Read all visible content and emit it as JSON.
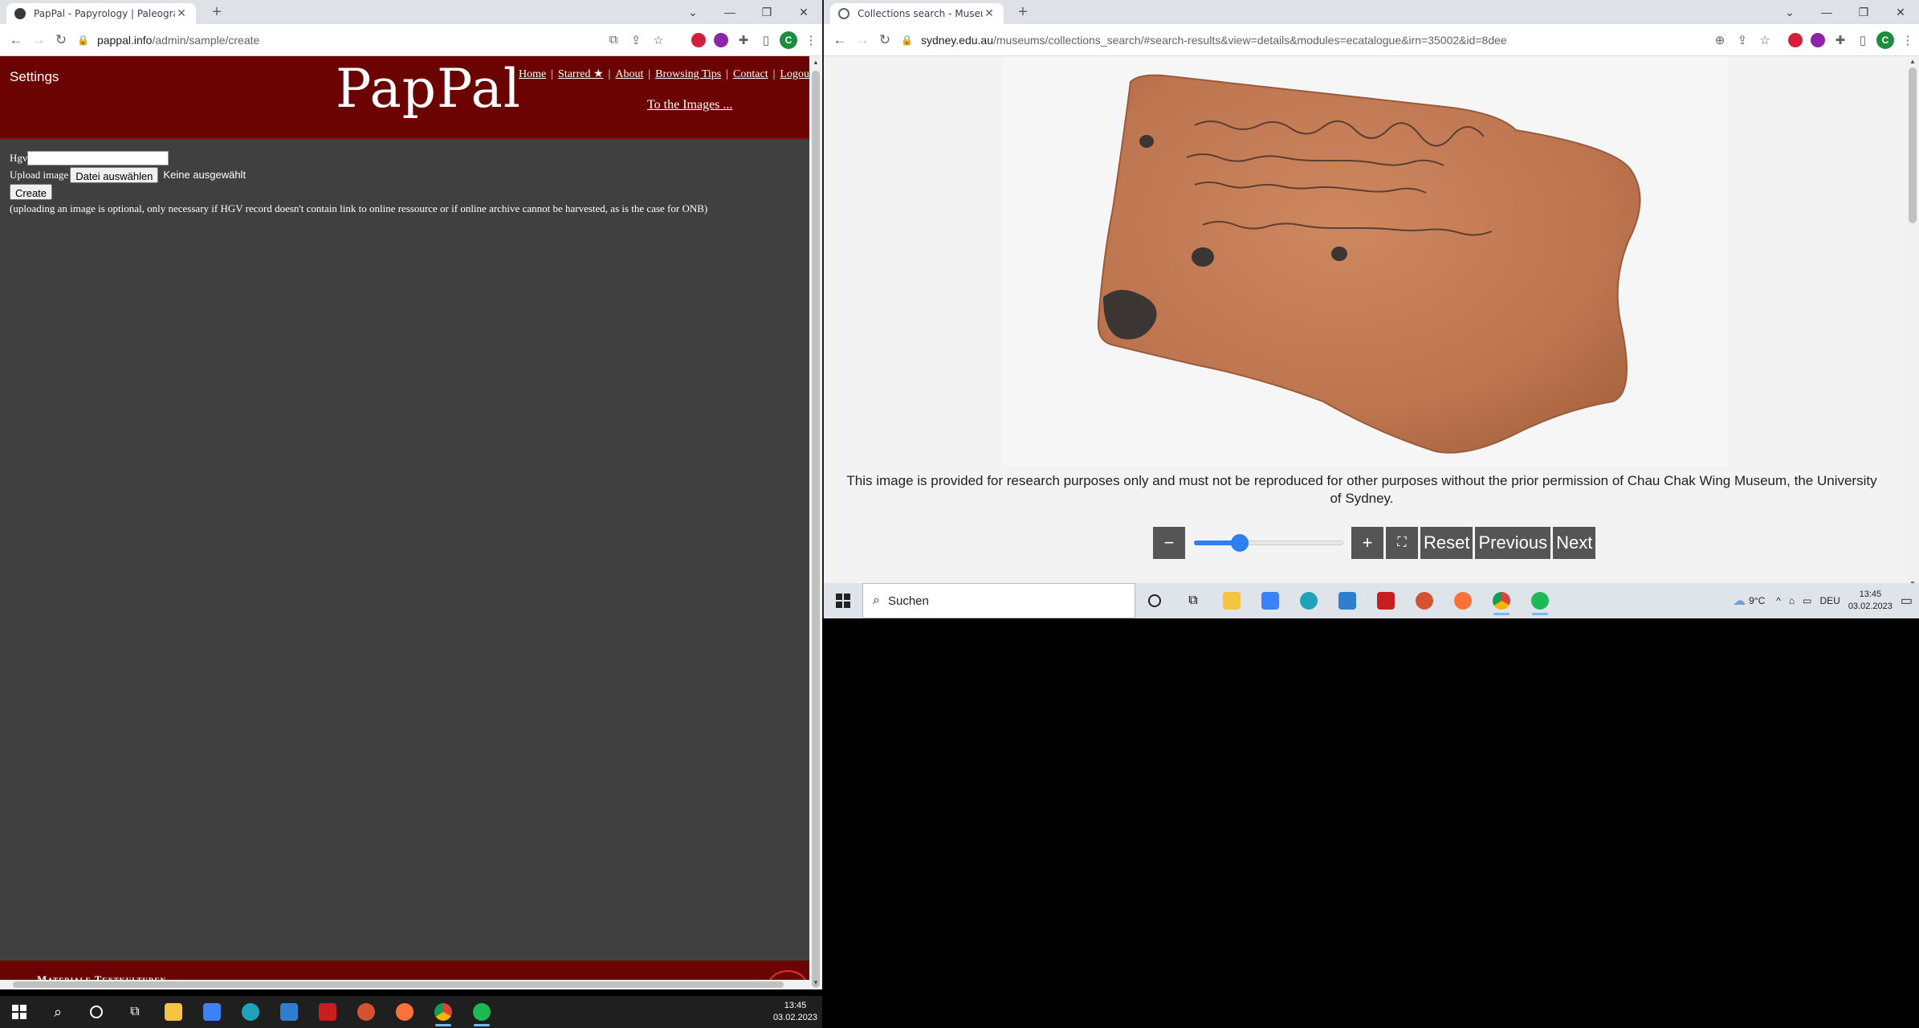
{
  "left_browser": {
    "tab_title": "PapPal - Papyrology | Paleograph",
    "url_host": "pappal.info",
    "url_path": "/admin/sample/create",
    "page": {
      "settings_label": "Settings",
      "logo": "PapPal",
      "nav": [
        "Home",
        "Starred ★",
        "About",
        "Browsing Tips",
        "Contact",
        "Logou"
      ],
      "images_link": "To the Images ...",
      "form": {
        "hgv_label": "Hgv",
        "hgv_value": "",
        "upload_label": "Upload image",
        "file_button": "Datei auswählen",
        "file_status": "Keine ausgewählt",
        "create_button": "Create",
        "note": "(uploading an image is optional, only necessary if HGV record doesn't contain link to online ressource or if online archive cannot be harvested, as is the case for ONB)"
      },
      "footer_text": "Materiale Textkulturen"
    }
  },
  "right_browser": {
    "tab_title": "Collections search - Museums -",
    "url_host": "sydney.edu.au",
    "url_path": "/museums/collections_search/#search-results&view=details&modules=ecatalogue&irn=35002&id=8dee",
    "caption": "This image is provided for research purposes only and must not be reproduced for other purposes without the prior permission of Chau Chak Wing Museum, the University of Sydney.",
    "controls": {
      "minus": "−",
      "plus": "+",
      "fullscreen": "⛶",
      "reset": "Reset",
      "previous": "Previous",
      "next": "Next",
      "zoom_fraction": 0.28
    }
  },
  "taskbar_right": {
    "search_placeholder": "Suchen",
    "weather": "9°C",
    "language": "DEU",
    "time": "13:45",
    "date": "03.02.2023"
  },
  "taskbar_left": {
    "time": "13:45",
    "date": "03.02.2023"
  },
  "colors": {
    "pappal_header": "#6b0303",
    "pappal_body": "#404040",
    "slider_accent": "#2c80f2"
  }
}
